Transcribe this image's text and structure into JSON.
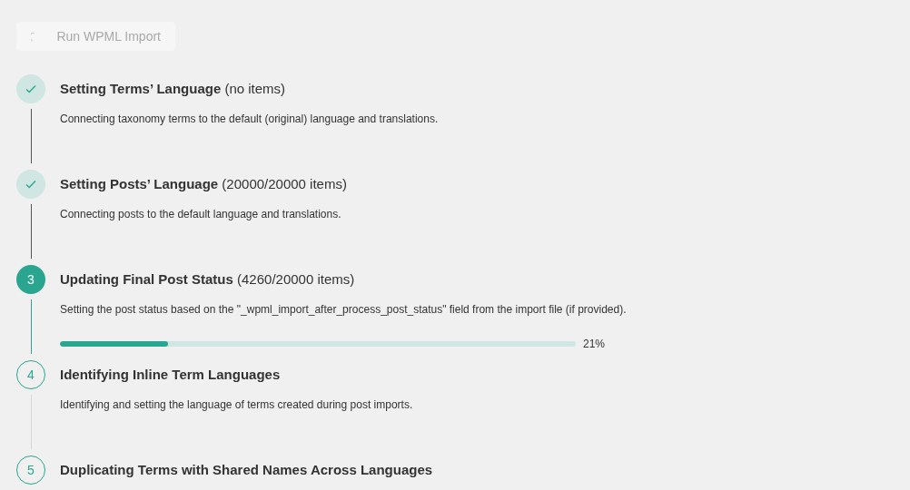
{
  "run_button": {
    "label": "Run WPML Import",
    "disabled": true,
    "loading": true
  },
  "steps": [
    {
      "kind": "done",
      "title": "**Setting Terms’ Language** (no items)",
      "description": "Connecting taxonomy terms to the default (original) language and translations."
    },
    {
      "kind": "done",
      "title": "**Setting Posts’ Language** (20000/20000 items)",
      "description": "Connecting posts to the default language and translations."
    },
    {
      "kind": "active",
      "number": "3",
      "title": "**Updating Final Post Status** (4260/20000 items)",
      "description": "Setting the post status based on the \"_wpml_import_after_process_post_status\" field from the import file (if provided).",
      "level": 0.21,
      "reading": "21%"
    },
    {
      "kind": "pending",
      "number": "4",
      "title": "**Identifying Inline Term Languages**",
      "description": "Identifying and setting the language of terms created during post imports."
    },
    {
      "kind": "pending",
      "number": "5",
      "title": "**Duplicating Terms with Shared Names Across Languages**"
    }
  ]
}
